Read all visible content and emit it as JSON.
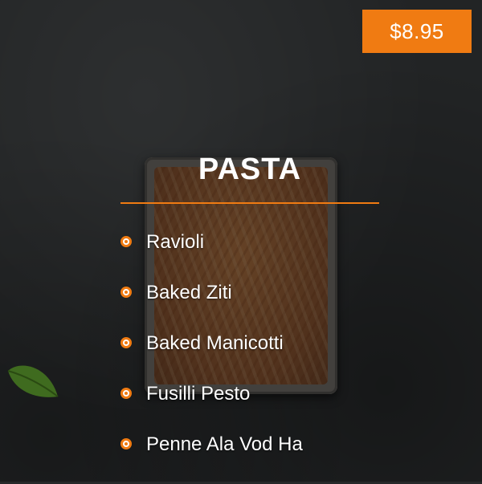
{
  "price": "$8.95",
  "colors": {
    "accent": "#f07b12",
    "text": "#ffffff",
    "background": "#222425"
  },
  "menu": {
    "title": "PASTA",
    "items": [
      {
        "label": "Ravioli"
      },
      {
        "label": "Baked Ziti"
      },
      {
        "label": "Baked Manicotti"
      },
      {
        "label": "Fusilli Pesto"
      },
      {
        "label": "Penne Ala Vod Ha"
      }
    ]
  },
  "icons": {
    "bullet": "radio-bullet-icon",
    "leaf": "basil-leaf-icon"
  }
}
